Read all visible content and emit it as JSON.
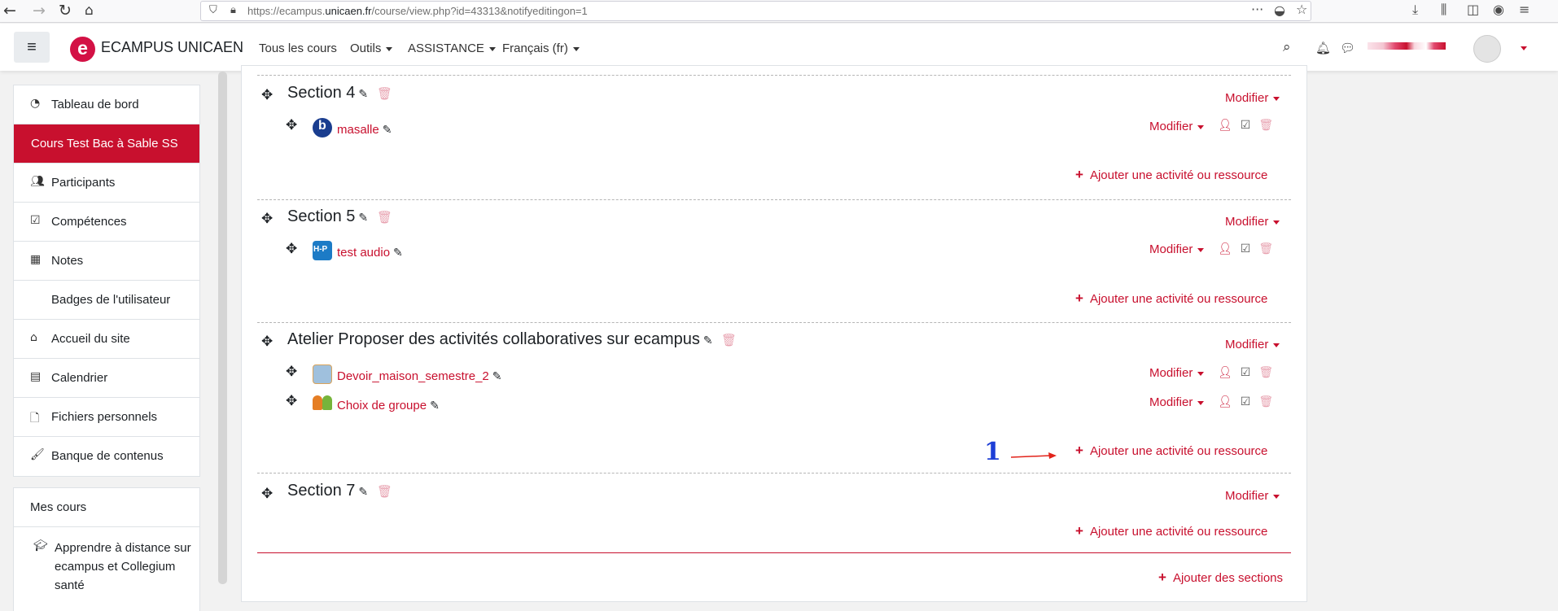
{
  "browser": {
    "url_prefix": "https://ecampus.",
    "url_domain": "unicaen.fr",
    "url_path": "/course/view.php?id=43313&notifyeditingon=1"
  },
  "navbar": {
    "brand": "ECAMPUS UNICAEN",
    "logo_letter": "e",
    "menu": [
      "Tous les cours",
      "Outils",
      "ASSISTANCE",
      "Français (fr)"
    ]
  },
  "drawer": {
    "items": [
      {
        "label": "Tableau de bord",
        "icon": "dashboard-icon"
      },
      {
        "label": "Cours Test Bac à Sable SS",
        "icon": ""
      },
      {
        "label": "Participants",
        "icon": "users-icon"
      },
      {
        "label": "Compétences",
        "icon": "check-square-icon"
      },
      {
        "label": "Notes",
        "icon": "table-icon"
      },
      {
        "label": "Badges de l'utilisateur",
        "icon": ""
      },
      {
        "label": "Accueil du site",
        "icon": "home-icon"
      },
      {
        "label": "Calendrier",
        "icon": "calendar-icon"
      },
      {
        "label": "Fichiers personnels",
        "icon": "file-icon"
      },
      {
        "label": "Banque de contenus",
        "icon": "brush-icon"
      }
    ],
    "mes_cours": {
      "title": "Mes cours",
      "course": "Apprendre à distance sur ecampus et Collegium santé"
    }
  },
  "sections": [
    {
      "title": "Section 4",
      "modifier": "Modifier",
      "activities": [
        {
          "name": "masalle",
          "icon": "bigbluebutton-icon",
          "modifier": "Modifier"
        }
      ],
      "add_label": "Ajouter une activité ou ressource"
    },
    {
      "title": "Section 5",
      "modifier": "Modifier",
      "activities": [
        {
          "name": "test audio",
          "icon": "h5p-icon",
          "modifier": "Modifier"
        }
      ],
      "add_label": "Ajouter une activité ou ressource"
    },
    {
      "title": "Atelier Proposer des activités collaboratives sur ecampus",
      "modifier": "Modifier",
      "activities": [
        {
          "name": "Devoir_maison_semestre_2",
          "icon": "assignment-icon",
          "modifier": "Modifier"
        },
        {
          "name": "Choix de groupe",
          "icon": "group-choice-icon",
          "modifier": "Modifier"
        }
      ],
      "add_label": "Ajouter une activité ou ressource"
    },
    {
      "title": "Section 7",
      "modifier": "Modifier",
      "activities": [],
      "add_label": "Ajouter une activité ou ressource"
    }
  ],
  "add_sections": "Ajouter des sections",
  "annotation": {
    "number": "1"
  },
  "colors": {
    "accent": "#c8102e",
    "brand": "#d31145",
    "annotation": "#1e3fd6"
  }
}
